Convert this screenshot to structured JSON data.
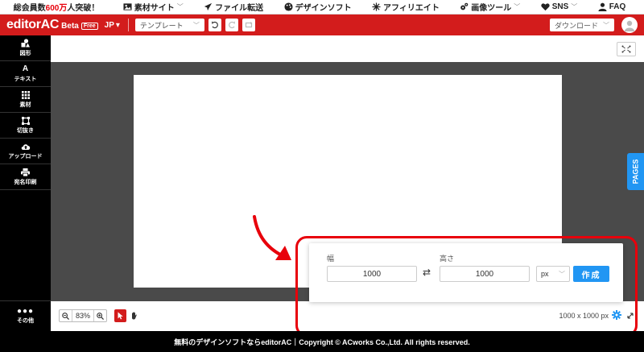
{
  "promo": {
    "prefix": "総会員数",
    "count": "600万",
    "suffix": "人突破！"
  },
  "topnav": [
    {
      "label": "素材サイト",
      "icon": "image-icon",
      "chev": true
    },
    {
      "label": "ファイル転送",
      "icon": "paper-plane-icon",
      "chev": false
    },
    {
      "label": "デザインソフト",
      "icon": "palette-icon",
      "chev": false
    },
    {
      "label": "アフィリエイト",
      "icon": "spark-icon",
      "chev": false
    },
    {
      "label": "画像ツール",
      "icon": "gears-icon",
      "chev": true
    },
    {
      "label": "SNS",
      "icon": "heart-icon",
      "chev": true
    },
    {
      "label": "FAQ",
      "icon": "user-question-icon",
      "chev": false
    }
  ],
  "header": {
    "brand": "editorAC",
    "beta": "Beta",
    "free": "Free",
    "lang": "JP",
    "template_label": "テンプレート",
    "download_label": "ダウンロード"
  },
  "sidebar": {
    "items": [
      {
        "label": "図形",
        "icon": "shapes-icon"
      },
      {
        "label": "テキスト",
        "icon": "text-icon"
      },
      {
        "label": "素材",
        "icon": "grid-icon"
      },
      {
        "label": "切抜き",
        "icon": "crop-icon"
      },
      {
        "label": "アップロード",
        "icon": "cloud-upload-icon"
      },
      {
        "label": "宛名印刷",
        "icon": "printer-icon"
      }
    ],
    "more_label": "その他"
  },
  "workspace": {
    "pages_tab": "PAGES",
    "zoom": "83%",
    "size_readout": "1000 x 1000 px"
  },
  "size_panel": {
    "width_label": "幅",
    "height_label": "高さ",
    "width_value": "1000",
    "height_value": "1000",
    "unit": "px",
    "create_label": "作成"
  },
  "footer": {
    "text": "無料のデザインソフトならeditorAC｜Copyright © ACworks Co.,Ltd. All rights reserved."
  },
  "colors": {
    "brand_red": "#d31c1c",
    "accent_blue": "#2196f3",
    "highlight_red": "#e8000b"
  }
}
